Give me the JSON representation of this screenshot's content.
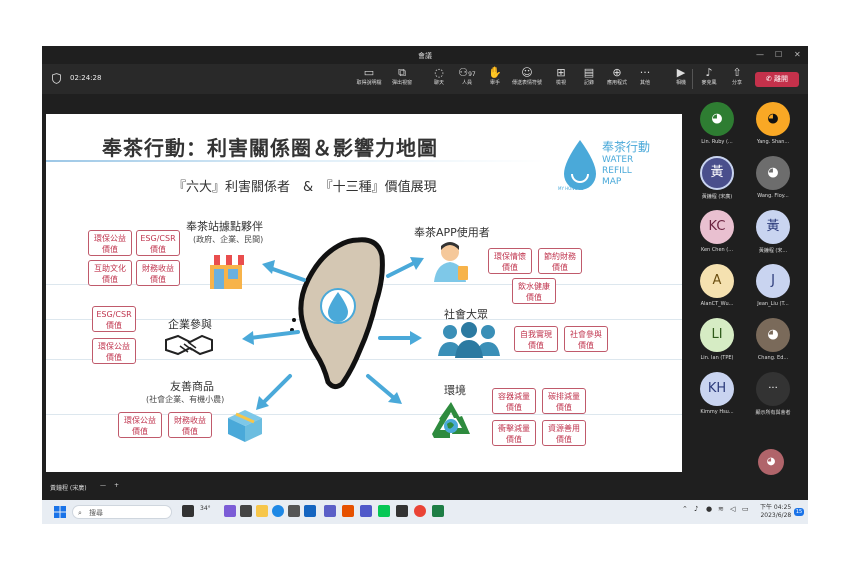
{
  "window": {
    "title": "會議"
  },
  "toolbar": {
    "timer": "02:24:28",
    "buttons": [
      {
        "label": "取得說明檔",
        "icon": "screen-icon"
      },
      {
        "label": "彈出視窗",
        "icon": "popout-icon"
      },
      {
        "label": "聊天",
        "icon": "chat-icon"
      },
      {
        "label": "人員",
        "icon": "people-icon",
        "count": "97"
      },
      {
        "label": "舉手",
        "icon": "raise-hand-icon"
      },
      {
        "label": "傳送表情符號",
        "icon": "reaction-icon"
      },
      {
        "label": "檢視",
        "icon": "view-icon"
      },
      {
        "label": "記錄",
        "icon": "notes-icon"
      },
      {
        "label": "應用程式",
        "icon": "apps-icon"
      },
      {
        "label": "其他",
        "icon": "more-icon"
      },
      {
        "label": "相機",
        "icon": "camera-off-icon"
      },
      {
        "label": "麥克風",
        "icon": "mic-off-icon"
      },
      {
        "label": "分享",
        "icon": "share-icon"
      }
    ],
    "leave_label": "離開"
  },
  "slide": {
    "title": "奉茶行動：利害關係圈＆影響力地圖",
    "subtitle": "『六大』利害關係者　&　『十三種』價值展現",
    "logo": {
      "cn": "奉茶行動",
      "en1": "WATER",
      "en2": "REFILL",
      "en3": "MAP",
      "caption": "MY HONG-YE"
    },
    "groups": {
      "partners": {
        "label": "奉茶站據點夥伴",
        "sub": "(政府、企業、民間)"
      },
      "enterprise": {
        "label": "企業參與"
      },
      "goods": {
        "label": "友善商品",
        "sub": "(社會企業、有機小農)"
      },
      "app_users": {
        "label": "奉茶APP使用者"
      },
      "public": {
        "label": "社會大眾"
      },
      "environment": {
        "label": "環境"
      }
    },
    "chips": {
      "c1": [
        "環保公益",
        "價值"
      ],
      "c2": [
        "ESG/CSR",
        "價值"
      ],
      "c3": [
        "互助文化",
        "價值"
      ],
      "c4": [
        "財務收益",
        "價值"
      ],
      "c5": [
        "ESG/CSR",
        "價值"
      ],
      "c6": [
        "環保公益",
        "價值"
      ],
      "c7": [
        "環保公益",
        "價值"
      ],
      "c8": [
        "財務收益",
        "價值"
      ],
      "c9": [
        "環保情懷",
        "價值"
      ],
      "c10": [
        "節約財務",
        "價值"
      ],
      "c11": [
        "飲水健康",
        "價值"
      ],
      "c12": [
        "自我實現",
        "價值"
      ],
      "c13": [
        "社會參與",
        "價值"
      ],
      "c14": [
        "容器減量",
        "價值"
      ],
      "c15": [
        "碳排減量",
        "價值"
      ],
      "c16": [
        "衝擊減量",
        "價值"
      ],
      "c17": [
        "資源善用",
        "價值"
      ]
    }
  },
  "participants": [
    {
      "name": "Lin. Ruby (...",
      "initials": "",
      "color": "#2e7d32"
    },
    {
      "name": "Yang. Shan...",
      "initials": "",
      "color": "#f9a825"
    },
    {
      "name": "黃鐘程 (宋廣)",
      "initials": "黃",
      "color": "#4a4f8c"
    },
    {
      "name": "Wang. Floy...",
      "initials": "",
      "color": "#6d6d6d"
    },
    {
      "name": "Ken Chen (...",
      "initials": "KC",
      "color": "#e9c0d0"
    },
    {
      "name": "黃鐘程 (宋...",
      "initials": "黃",
      "color": "#c9d4f0"
    },
    {
      "name": "AlanCT_Wu...",
      "initials": "A",
      "color": "#f5e1b0"
    },
    {
      "name": "Jean_Liu (T...",
      "initials": "J",
      "color": "#c9d4f0"
    },
    {
      "name": "Lin. Ian (TPE)",
      "initials": "LI",
      "color": "#d6ecc4"
    },
    {
      "name": "Chang. Ed...",
      "initials": "",
      "color": "#7a6a5a"
    },
    {
      "name": "Kimmy Hsu...",
      "initials": "KH",
      "color": "#c9d4f0"
    },
    {
      "name": "顯示所有與會者",
      "initials": "",
      "color": "#333333"
    }
  ],
  "bottom": {
    "presenter": "黃鐘程 (宋廣)",
    "zoom_out": "—",
    "zoom_in": "+"
  },
  "taskbar": {
    "search_placeholder": "搜尋",
    "weather": "34°",
    "time": "下午 04:25",
    "date": "2023/6/28",
    "notification": "15"
  }
}
